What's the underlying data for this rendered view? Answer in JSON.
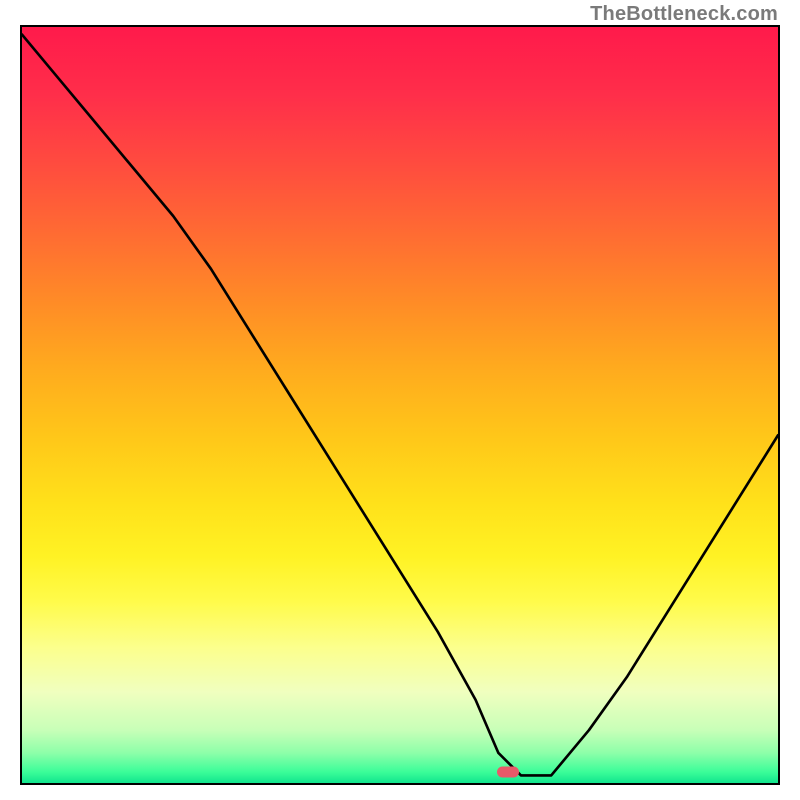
{
  "watermark": "TheBottleneck.com",
  "gradient": {
    "stops": [
      {
        "pct": 0.0,
        "color": "#ff1a4b"
      },
      {
        "pct": 0.09,
        "color": "#ff2e4a"
      },
      {
        "pct": 0.18,
        "color": "#ff4b3f"
      },
      {
        "pct": 0.27,
        "color": "#ff6a33"
      },
      {
        "pct": 0.36,
        "color": "#ff8a27"
      },
      {
        "pct": 0.45,
        "color": "#ffaa1e"
      },
      {
        "pct": 0.54,
        "color": "#ffc619"
      },
      {
        "pct": 0.63,
        "color": "#ffe11a"
      },
      {
        "pct": 0.7,
        "color": "#fff224"
      },
      {
        "pct": 0.76,
        "color": "#fffb4a"
      },
      {
        "pct": 0.82,
        "color": "#fcff8c"
      },
      {
        "pct": 0.88,
        "color": "#f0ffbf"
      },
      {
        "pct": 0.93,
        "color": "#c8ffb8"
      },
      {
        "pct": 0.96,
        "color": "#8dffa9"
      },
      {
        "pct": 0.985,
        "color": "#3bfd99"
      },
      {
        "pct": 1.0,
        "color": "#11e58e"
      }
    ]
  },
  "marker": {
    "x_pct": 0.643,
    "y_pct": 0.985,
    "color": "#e85a69"
  },
  "chart_data": {
    "type": "line",
    "title": "",
    "xlabel": "",
    "ylabel": "",
    "xlim": [
      0,
      100
    ],
    "ylim": [
      0,
      100
    ],
    "x": [
      0,
      5,
      10,
      15,
      20,
      25,
      30,
      35,
      40,
      45,
      50,
      55,
      60,
      63,
      66,
      70,
      75,
      80,
      85,
      90,
      95,
      100
    ],
    "values": [
      99,
      93,
      87,
      81,
      75,
      68,
      60,
      52,
      44,
      36,
      28,
      20,
      11,
      4,
      1,
      1,
      7,
      14,
      22,
      30,
      38,
      46
    ],
    "notes": "V-shaped bottleneck curve. x ≈ position (relative scale), value ≈ bottleneck percent. Flat minimum ≈ 0 around x 63–70 where the pink marker sits. Left branch starts at the top-left corner and descends with a slight slope break near x ≈ 25; right branch rises roughly linearly to about 46 at x = 100."
  }
}
